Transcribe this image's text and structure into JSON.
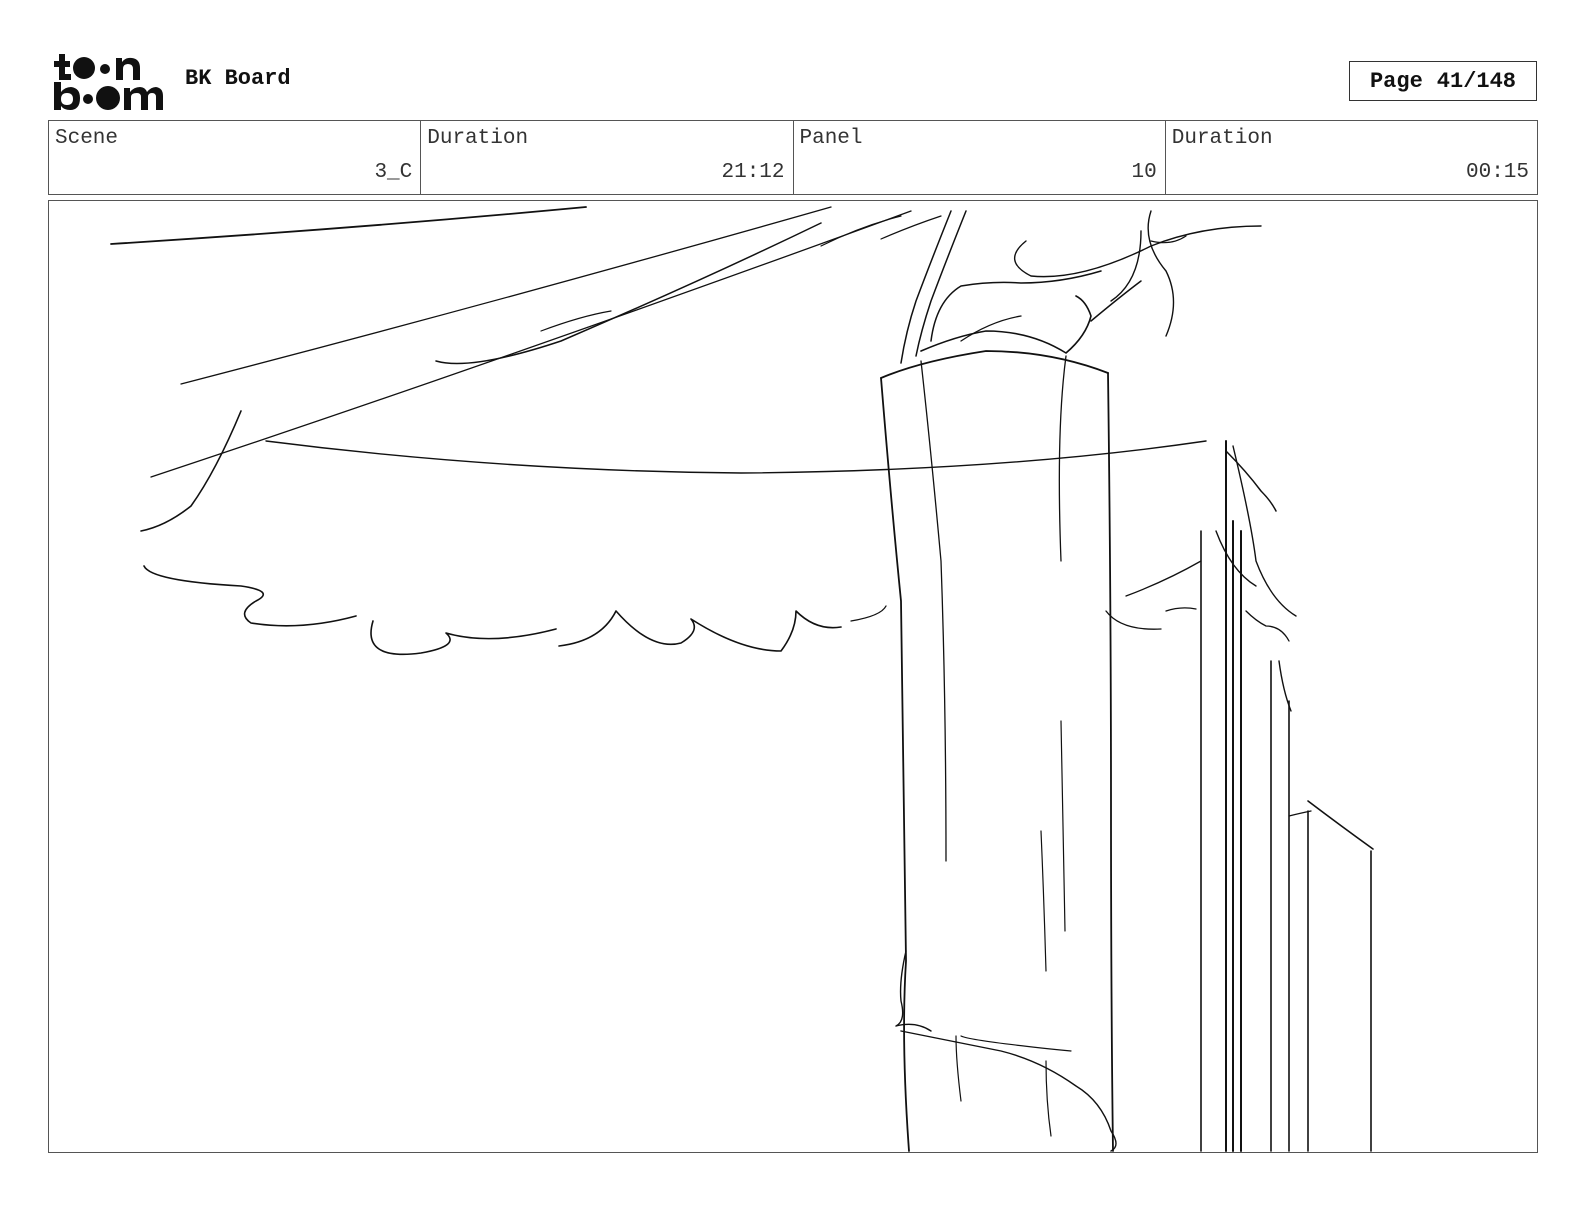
{
  "header": {
    "logo_text_top": "toon",
    "logo_text_bottom": "boom",
    "project_title": "BK Board",
    "page_label": "Page",
    "page_value": "41/148"
  },
  "info": [
    {
      "label": "Scene",
      "value": "3_C"
    },
    {
      "label": "Duration",
      "value": "21:12"
    },
    {
      "label": "Panel",
      "value": "10"
    },
    {
      "label": "Duration",
      "value": "00:15"
    }
  ]
}
